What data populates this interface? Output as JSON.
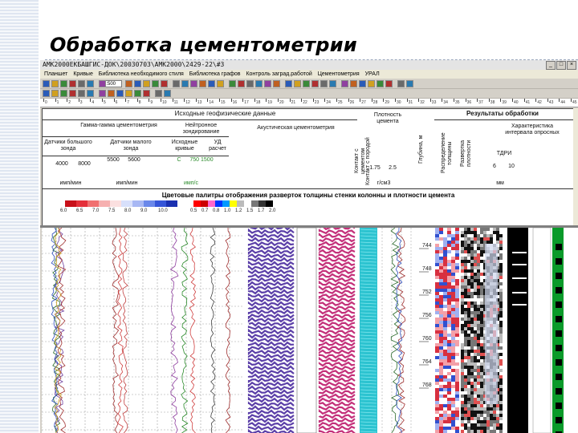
{
  "slide": {
    "title": "Обработка цементометрии"
  },
  "window": {
    "title": "АМК2000ЕКБАШГИС-ДОК\\20030703\\АМК2000\\2429-22\\#3",
    "buttons": [
      "_",
      "□",
      "×"
    ]
  },
  "menu": [
    "Планшет",
    "Кривые",
    "Библиотека необходимого стиля",
    "Библиотека графов",
    "Контроль заград.работой",
    "Цементометрия",
    "УРАЛ"
  ],
  "toolbar": {
    "combo_value": "1:500"
  },
  "ruler": {
    "start": 0,
    "end": 45
  },
  "header": {
    "section_left": "Исходные геофизические данные",
    "section_right": "Результаты обработки",
    "col_gamma": "Гамма-гамма цементометрия",
    "col_neutron": "Нейтронное зондирование",
    "col_acoustic": "Акустическая цементометрия",
    "col_density": "Плотность цемента",
    "col_depth": "Глубина, м",
    "col_contact_cement": "Контакт с цементом",
    "col_contact_rock": "Контакт с породой",
    "sub_large": "Датчики большого зонда",
    "sub_small": "Датчики малого зонда",
    "sub_initial": "Исходные кривые",
    "sub_ud": "УД расчет",
    "res_column_type": "Распределение толщины",
    "res_reliability": "Развертка плотности",
    "res_char": "Характеристика интервала опросных",
    "res_tdri": "ТДРИ",
    "scale_gamma_a": "4000",
    "scale_gamma_b": "8000",
    "scale_small_a": "5500",
    "scale_small_b": "5600",
    "scale_neutron_a": "C",
    "scale_neutron_b": "750 1500",
    "scale_density_a": "1.75",
    "scale_density_b": "2.5",
    "scale_tdri_a": "6",
    "scale_tdri_b": "10",
    "unit_gamma": "имп/мин",
    "unit_small": "имп/мин",
    "unit_neutron": "имп/с",
    "unit_density": "г/см3",
    "unit_res": "мм",
    "palette_title": "Цветовые палитры отображения разверток толщины стенки колонны и плотности цемента",
    "palette_left_labels": [
      "6.0",
      "6.5",
      "7.0",
      "7.5",
      "8.0",
      "9.0",
      "10.0"
    ],
    "palette_right_labels": [
      "0.5",
      "0.7",
      "0.8",
      "1.0",
      "1.2",
      "1.5",
      "1.7",
      "2.0"
    ]
  },
  "depth_labels": [
    "744",
    "748",
    "752",
    "756",
    "760",
    "764",
    "768"
  ],
  "colors": {
    "window_bg": "#d4d0c8",
    "blue_track": "#5b3fa8",
    "magenta_track": "#c4307a",
    "cyan_track": "#2cc3d0",
    "green_bar": "#0a9a2a"
  }
}
